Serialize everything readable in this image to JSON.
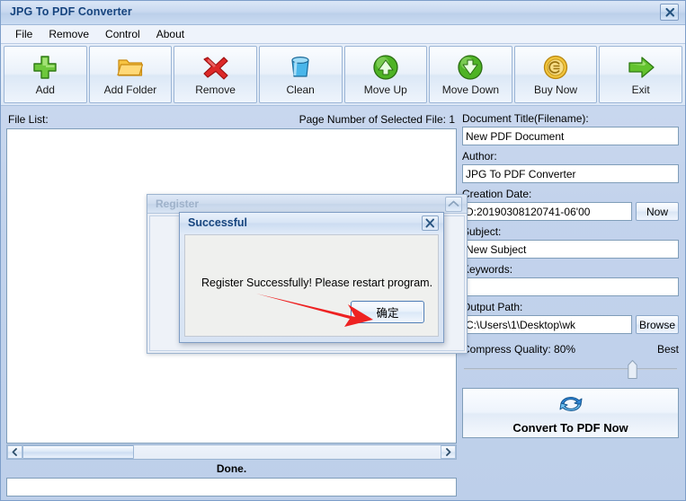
{
  "window": {
    "title": "JPG To PDF Converter",
    "close_icon": "close-icon"
  },
  "menubar": {
    "items": [
      {
        "label": "File"
      },
      {
        "label": "Remove"
      },
      {
        "label": "Control"
      },
      {
        "label": "About"
      }
    ]
  },
  "toolbar": {
    "buttons": [
      {
        "label": "Add",
        "icon": "plus-icon"
      },
      {
        "label": "Add Folder",
        "icon": "folder-icon"
      },
      {
        "label": "Remove",
        "icon": "red-x-icon"
      },
      {
        "label": "Clean",
        "icon": "bucket-icon"
      },
      {
        "label": "Move Up",
        "icon": "arrow-up-circle-icon"
      },
      {
        "label": "Move Down",
        "icon": "arrow-down-circle-icon"
      },
      {
        "label": "Buy Now",
        "icon": "coin-icon"
      },
      {
        "label": "Exit",
        "icon": "green-arrow-right-icon"
      }
    ]
  },
  "left_pane": {
    "file_list_label": "File List:",
    "page_number_label": "Page Number of Selected File: 1",
    "status_text": "Done.",
    "scroll_left_icon": "chevron-left-icon",
    "scroll_right_icon": "chevron-right-icon"
  },
  "right_pane": {
    "document_title": {
      "label": "Document Title(Filename):",
      "value": "New PDF Document",
      "placeholder": ""
    },
    "author": {
      "label": "Author:",
      "value": "JPG To PDF Converter",
      "placeholder": ""
    },
    "creation_date": {
      "label": "Creation Date:",
      "value": "D:20190308120741-06'00",
      "placeholder": "",
      "now_button": "Now"
    },
    "subject": {
      "label": "Subject:",
      "value": "New Subject",
      "placeholder": ""
    },
    "keywords": {
      "label": "Keywords:",
      "value": "",
      "placeholder": ""
    },
    "output_path": {
      "label": "Output Path:",
      "value": "C:\\Users\\1\\Desktop\\wk",
      "placeholder": "",
      "browse_button": "Browse"
    },
    "compress_quality": {
      "label": "Compress Quality: 80%",
      "right_label": "Best",
      "value": 80
    },
    "convert_button": {
      "label": "Convert To PDF Now",
      "icon": "convert-refresh-icon"
    }
  },
  "register_window": {
    "title": "Register",
    "maximize_icon": "maximize-icon"
  },
  "success_dialog": {
    "title": "Successful",
    "message": "Register Successfully! Please restart program.",
    "ok_button": "确定",
    "close_icon": "close-icon"
  },
  "annotation": {
    "arrow_color": "#ee2222",
    "name": "red-arrow-pointing-to-ok-button"
  },
  "colors": {
    "titlebar_text": "#16447e",
    "window_bg": "#c3d3ec",
    "field_bg": "#ffffff",
    "accent": "#4a7ab5"
  }
}
